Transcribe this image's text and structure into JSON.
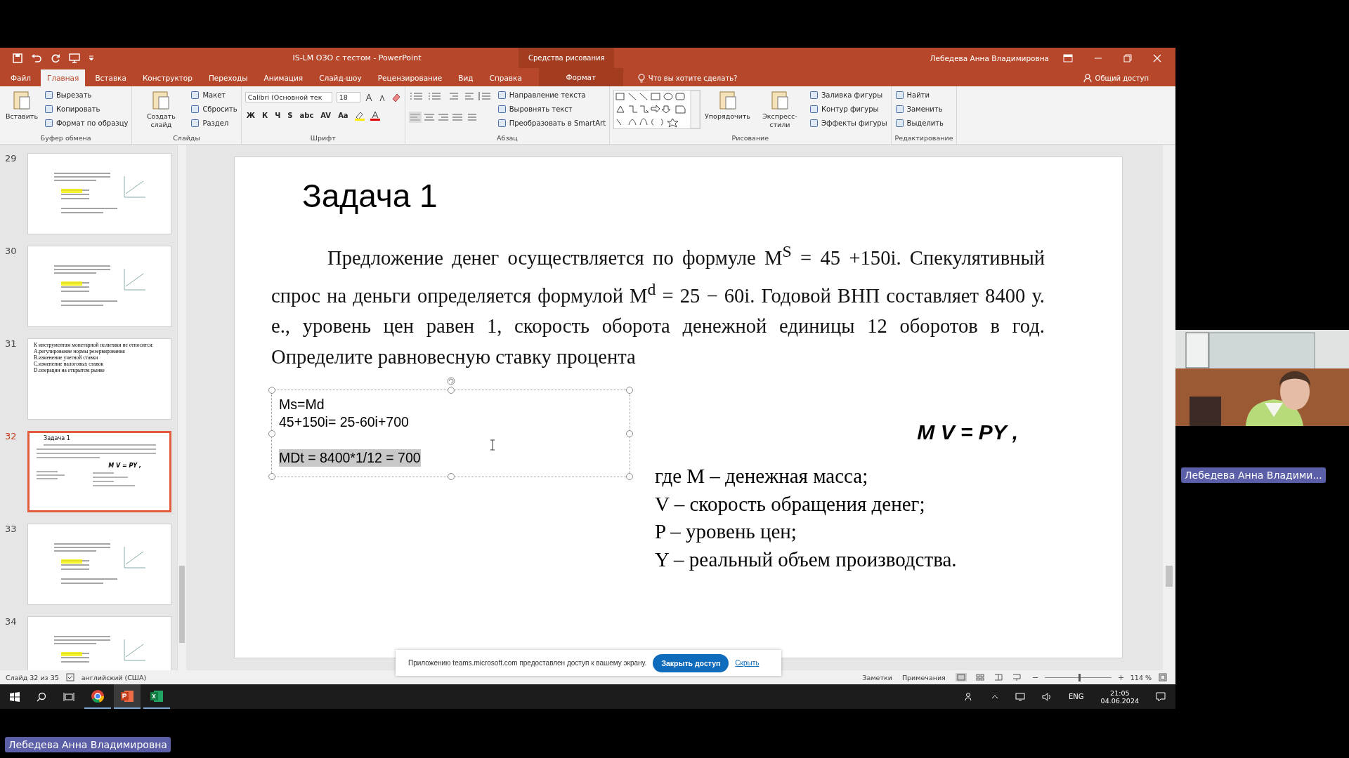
{
  "ppt_window": {
    "title": "IS-LM ОЗО с тестом  -  PowerPoint",
    "context_group": "Средства рисования",
    "account": "Лебедева Анна Владимировна",
    "tabs": [
      {
        "label": "Файл",
        "selected": false,
        "kind": "normal"
      },
      {
        "label": "Главная",
        "selected": true,
        "kind": "normal"
      },
      {
        "label": "Вставка",
        "selected": false,
        "kind": "normal"
      },
      {
        "label": "Конструктор",
        "selected": false,
        "kind": "normal"
      },
      {
        "label": "Переходы",
        "selected": false,
        "kind": "normal"
      },
      {
        "label": "Анимация",
        "selected": false,
        "kind": "normal"
      },
      {
        "label": "Слайд-шоу",
        "selected": false,
        "kind": "normal"
      },
      {
        "label": "Рецензирование",
        "selected": false,
        "kind": "normal"
      },
      {
        "label": "Вид",
        "selected": false,
        "kind": "normal"
      },
      {
        "label": "Справка",
        "selected": false,
        "kind": "normal"
      },
      {
        "label": "Формат",
        "selected": false,
        "kind": "contextual"
      }
    ],
    "tell_me": "Что вы хотите сделать?",
    "share": "Общий доступ",
    "ribbon": [
      {
        "label": "Буфер обмена",
        "items": [
          {
            "kind": "large",
            "label": "Вставить"
          },
          {
            "kind": "stack",
            "items": [
              "Вырезать",
              "Копировать",
              "Формат по образцу"
            ]
          }
        ]
      },
      {
        "label": "Слайды",
        "items": [
          {
            "kind": "large",
            "label": "Создать слайд"
          },
          {
            "kind": "stack",
            "items": [
              "Макет",
              "Сбросить",
              "Раздел"
            ]
          }
        ]
      },
      {
        "label": "Шрифт",
        "items": [
          {
            "kind": "font",
            "font": "Calibri (Основной тек",
            "size": "18",
            "glyphs": [
              "Ж",
              "К",
              "Ч",
              "S",
              "abc",
              "AV",
              "Aa"
            ]
          }
        ]
      },
      {
        "label": "Абзац",
        "items": [
          {
            "kind": "paragraph-tools"
          },
          {
            "kind": "stack",
            "items": [
              "Направление текста",
              "Выровнять текст",
              "Преобразовать в SmartArt"
            ]
          }
        ]
      },
      {
        "label": "Рисование",
        "items": [
          {
            "kind": "shape-gallery"
          },
          {
            "kind": "large",
            "label": "Упорядочить"
          },
          {
            "kind": "large",
            "label": "Экспресс-стили"
          },
          {
            "kind": "stack",
            "items": [
              "Заливка фигуры",
              "Контур фигуры",
              "Эффекты фигуры"
            ]
          }
        ]
      },
      {
        "label": "Редактирование",
        "items": [
          {
            "kind": "stack",
            "items": [
              "Найти",
              "Заменить",
              "Выделить"
            ]
          }
        ]
      }
    ],
    "thumbnails": [
      {
        "number": "29",
        "selected": false,
        "kind": "lines"
      },
      {
        "number": "30",
        "selected": false,
        "kind": "lines"
      },
      {
        "number": "31",
        "selected": false,
        "kind": "text",
        "lines": [
          "К инструментам монетарной политики не относится:",
          "А.регулирование нормы резервирования",
          "B.изменение учетной ставки",
          "C.изменение налоговых ставок",
          "D.операции на открытом рынке"
        ]
      },
      {
        "number": "32",
        "selected": true,
        "kind": "mini",
        "title": "Задача 1",
        "formula": "M V = PY ,"
      },
      {
        "number": "33",
        "selected": false,
        "kind": "lines"
      },
      {
        "number": "34",
        "selected": false,
        "kind": "lines"
      }
    ],
    "slide": {
      "title": "Задача 1",
      "problem": "Предложение денег осуществляется по формуле M$^{S}$ = 45 +150i. Спекулятивный спрос на деньги определяется формулой M$^{d}$ = 25 − 60i. Годовой ВНП составляет 8400 у. е., уровень цен равен 1, скорость оборота денежной единицы 12 оборотов в год. Определите равновесную ставку процента",
      "text_box": {
        "selected": true,
        "lines": [
          {
            "text": "Ms=Md",
            "highlighted": false
          },
          {
            "text": "45+150i= 25-60i+700",
            "highlighted": false
          },
          {
            "text": "MDt = 8400*1/12 = 700",
            "highlighted": true
          }
        ]
      },
      "formula": "M V = PY ,",
      "legend": [
        "где M – денежная масса;",
        "V – скорость обращения денег;",
        "P – уровень цен;",
        "Y – реальный объем производства."
      ]
    },
    "status_bar": {
      "slide_info": "Слайд 32 из 35",
      "language": "английский (США)",
      "notes": "Заметки",
      "comments": "Примечания",
      "zoom_slider": {
        "level": 0.52
      },
      "zoom": "114 %"
    }
  },
  "share_notice": {
    "text": "Приложению teams.microsoft.com предоставлен доступ к вашему экрану.",
    "stop_button": "Закрыть доступ",
    "hide_link": "Скрыть"
  },
  "taskbar": {
    "apps": [
      {
        "kind": "chrome",
        "selected": false
      },
      {
        "kind": "powerpoint",
        "selected": true
      },
      {
        "kind": "excel",
        "selected": false
      }
    ],
    "language": "ENG",
    "time": "21:05",
    "date": "04.06.2024"
  },
  "presenter_label": "Лебедева Анна Владимировна",
  "video": {
    "kind": "picture",
    "name": "Лебедева Анна Владими..."
  }
}
